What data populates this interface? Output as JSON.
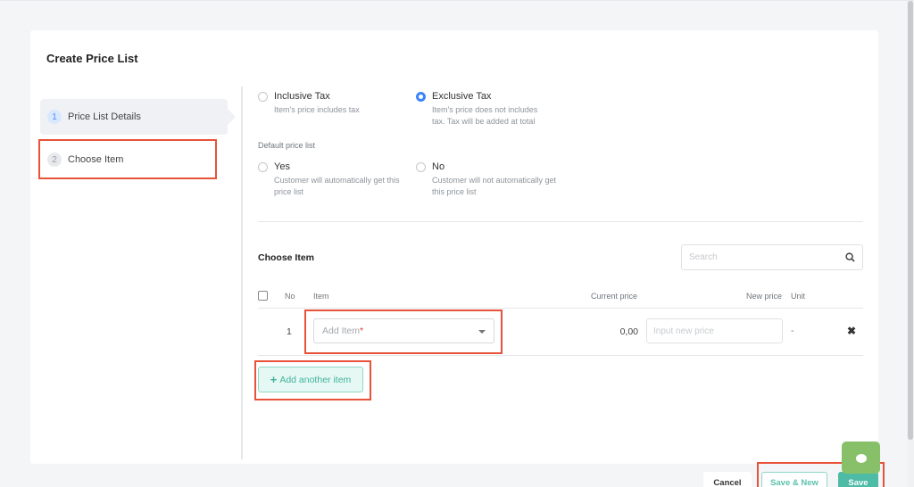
{
  "page": {
    "title": "Create Price List"
  },
  "steps": [
    {
      "number": "1",
      "label": "Price List Details",
      "active": true
    },
    {
      "number": "2",
      "label": "Choose Item",
      "active": false
    }
  ],
  "tax": {
    "options": [
      {
        "label": "Inclusive Tax",
        "desc": "Item's price includes tax",
        "checked": false
      },
      {
        "label": "Exclusive Tax",
        "desc": "Item's price does not includes tax. Tax will be added at total",
        "checked": true
      }
    ]
  },
  "default_price_list": {
    "label": "Default price list",
    "options": [
      {
        "label": "Yes",
        "desc": "Customer will automatically get this price list",
        "checked": false
      },
      {
        "label": "No",
        "desc": "Customer will not automatically get this price list",
        "checked": false
      }
    ]
  },
  "choose_item": {
    "title": "Choose Item",
    "search_placeholder": "Search",
    "columns": {
      "no": "No",
      "item": "Item",
      "current_price": "Current price",
      "new_price": "New price",
      "unit": "Unit"
    },
    "rows": [
      {
        "no": "1",
        "item_placeholder": "Add Item",
        "required_mark": "*",
        "current_price": "0,00",
        "new_price_placeholder": "Input new price",
        "unit": "-"
      }
    ],
    "add_button": "Add another item",
    "remove_symbol": "✖"
  },
  "footer": {
    "cancel": "Cancel",
    "save_new": "Save & New",
    "save": "Save"
  },
  "colors": {
    "accent_blue": "#3e86f5",
    "accent_teal": "#4dbba6",
    "highlight_red": "#e8523a",
    "chat_green": "#88c06a"
  }
}
